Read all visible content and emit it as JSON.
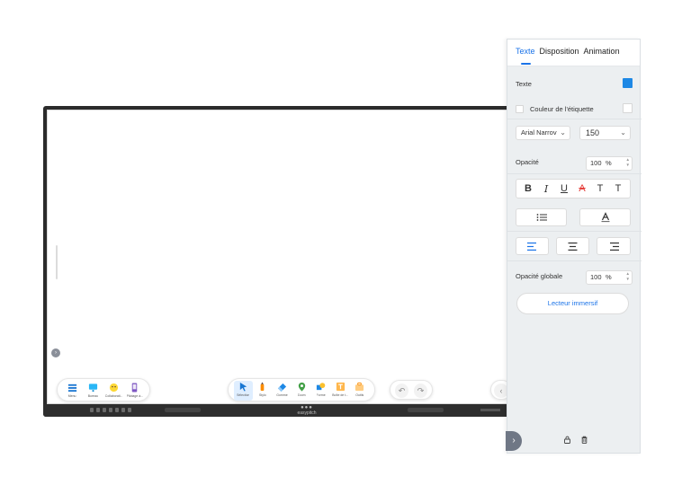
{
  "toolbar_left": {
    "items": [
      {
        "label": "Menu",
        "icon": "menu-icon"
      },
      {
        "label": "Bureau",
        "icon": "desktop-icon"
      },
      {
        "label": "Collaborati...",
        "icon": "collaboration-icon"
      },
      {
        "label": "Pilotage à...",
        "icon": "remote-control-icon"
      }
    ]
  },
  "toolbar_center": {
    "items": [
      {
        "label": "Sélection",
        "icon": "cursor-icon",
        "active": true
      },
      {
        "label": "Stylo",
        "icon": "pen-icon"
      },
      {
        "label": "Gomme",
        "icon": "eraser-icon"
      },
      {
        "label": "Zoom",
        "icon": "zoom-icon"
      },
      {
        "label": "Forme",
        "icon": "shape-icon"
      },
      {
        "label": "Boîte de t...",
        "icon": "textbox-icon"
      },
      {
        "label": "Outils",
        "icon": "tools-icon"
      }
    ]
  },
  "board": {
    "brand": "easypitch",
    "brand_dots": "●●●"
  },
  "panel": {
    "tabs": [
      "Texte",
      "Disposition",
      "Animation"
    ],
    "active_tab": "Texte",
    "text_label": "Texte",
    "text_color": "#1e88e5",
    "label_color_label": "Couleur de l'étiquette",
    "font_family": "Arial Narrov",
    "font_size": "150",
    "opacity_label": "Opacité",
    "opacity_value": "100",
    "opacity_unit": "%",
    "format_buttons": [
      "B",
      "I",
      "U",
      "A",
      "T",
      "T"
    ],
    "global_opacity_label": "Opacité globale",
    "global_opacity_value": "100",
    "global_opacity_unit": "%",
    "immersive_reader": "Lecteur immersif"
  },
  "colors": {
    "accent": "#1a73e8",
    "panel_bg": "#eceff1",
    "board_frame": "#2b2b2b"
  }
}
